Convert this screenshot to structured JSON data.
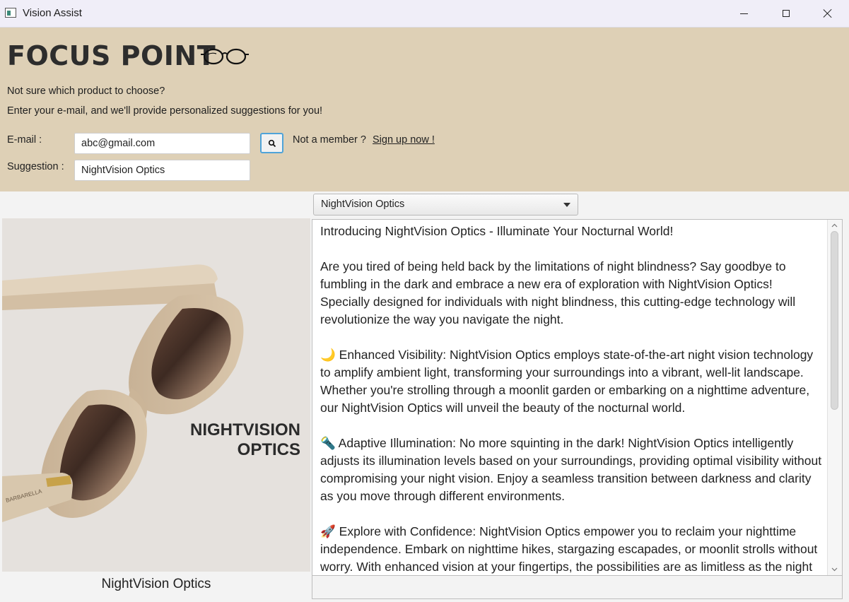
{
  "window": {
    "title": "Vision Assist"
  },
  "header": {
    "brand": "FOCUS POINT",
    "logo_icon": "glasses-icon",
    "intro_line1": "Not sure which product to choose?",
    "intro_line2": "Enter your e-mail, and we'll provide personalized suggestions for you!",
    "email_label": "E-mail :",
    "email_value": "abc@gmail.com",
    "suggestion_label": "Suggestion :",
    "suggestion_value": "NightVision Optics",
    "search_icon": "search-icon",
    "member_text": "Not a member ?",
    "signup_link": "Sign up now !",
    "background": "#ded0b6"
  },
  "product": {
    "selected": "NightVision Optics",
    "image_text_line1": "NIGHTVISION",
    "image_text_line2": "OPTICS",
    "image_brand_text": "BARBARELLA",
    "caption": "NightVision Optics"
  },
  "description": {
    "paragraphs": [
      "Introducing NightVision Optics - Illuminate Your Nocturnal World!",
      "Are you tired of being held back by the limitations of night blindness? Say goodbye to fumbling in the dark and embrace a new era of exploration with NightVision Optics! Specially designed for individuals with night blindness, this cutting-edge technology will revolutionize the way you navigate the night.",
      "🌙 Enhanced Visibility: NightVision Optics employs state-of-the-art night vision technology to amplify ambient light, transforming your surroundings into a vibrant, well-lit landscape. Whether you're strolling through a moonlit garden or embarking on a nighttime adventure, our NightVision Optics will unveil the beauty of the nocturnal world.",
      "🔦 Adaptive Illumination: No more squinting in the dark! NightVision Optics intelligently adjusts its illumination levels based on your surroundings, providing optimal visibility without compromising your night vision. Enjoy a seamless transition between darkness and clarity as you move through different environments.",
      "🚀 Explore with Confidence: NightVision Optics empower you to reclaim your nighttime independence. Embark on nighttime hikes, stargazing escapades, or moonlit strolls without worry. With enhanced vision at your fingertips, the possibilities are as limitless as the night"
    ]
  }
}
